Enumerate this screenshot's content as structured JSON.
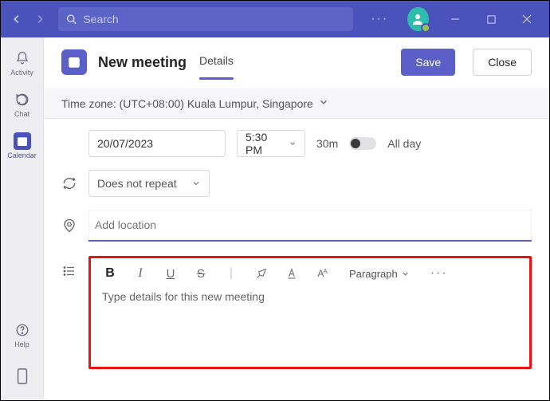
{
  "search": {
    "placeholder": "Search"
  },
  "leftnav": {
    "activity": "Activity",
    "chat": "Chat",
    "calendar": "Calendar",
    "help": "Help"
  },
  "header": {
    "title": "New meeting",
    "tab_details": "Details",
    "save": "Save",
    "close": "Close"
  },
  "timezone": {
    "label": "Time zone: (UTC+08:00) Kuala Lumpur, Singapore"
  },
  "date": {
    "value": "20/07/2023",
    "time": "5:30 PM",
    "duration": "30m",
    "allday": "All day"
  },
  "repeat": {
    "value": "Does not repeat"
  },
  "location": {
    "placeholder": "Add location"
  },
  "editor": {
    "paragraph": "Paragraph",
    "placeholder": "Type details for this new meeting"
  }
}
